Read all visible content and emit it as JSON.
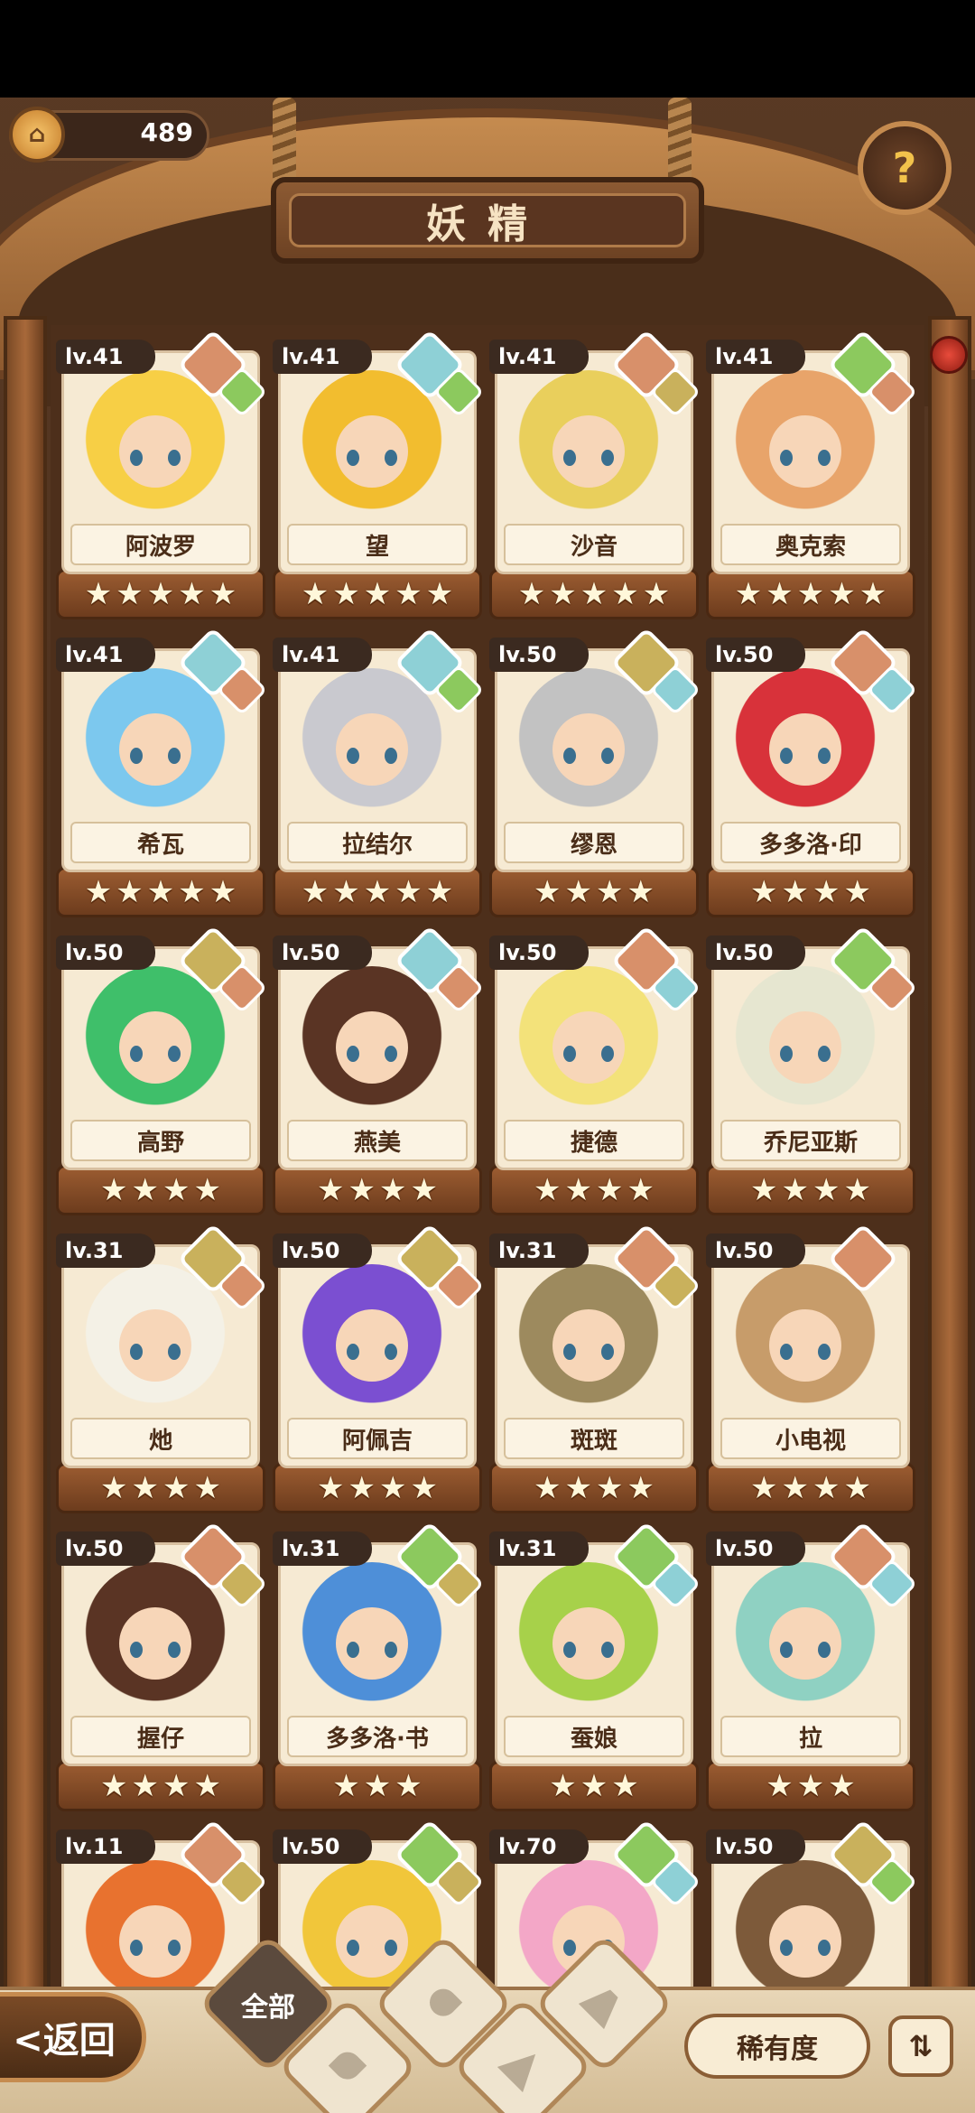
{
  "currency": {
    "icon": "coin-home-icon",
    "value": "489"
  },
  "title": "妖精",
  "help_icon": "question-leaf-icon",
  "fairies": [
    {
      "level": "lv.41",
      "name": "阿波罗",
      "stars": 5,
      "elements": [
        "fire",
        "leaf"
      ],
      "hair": "#f7cf45"
    },
    {
      "level": "lv.41",
      "name": "望",
      "stars": 5,
      "elements": [
        "water",
        "leaf"
      ],
      "hair": "#f2bd2f"
    },
    {
      "level": "lv.41",
      "name": "沙音",
      "stars": 5,
      "elements": [
        "fire",
        "earth"
      ],
      "hair": "#e9cf5c"
    },
    {
      "level": "lv.41",
      "name": "奥克索",
      "stars": 5,
      "elements": [
        "leaf",
        "fire"
      ],
      "hair": "#e8a46a"
    },
    {
      "level": "lv.41",
      "name": "希瓦",
      "stars": 5,
      "elements": [
        "water",
        "fire"
      ],
      "hair": "#7cc8ee"
    },
    {
      "level": "lv.41",
      "name": "拉结尔",
      "stars": 5,
      "elements": [
        "water",
        "leaf"
      ],
      "hair": "#c9c9cf"
    },
    {
      "level": "lv.50",
      "name": "缪恩",
      "stars": 4,
      "elements": [
        "earth",
        "water"
      ],
      "hair": "#c2c2c2"
    },
    {
      "level": "lv.50",
      "name": "多多洛·印",
      "stars": 4,
      "elements": [
        "fire",
        "water"
      ],
      "hair": "#d8323a"
    },
    {
      "level": "lv.50",
      "name": "高野",
      "stars": 4,
      "elements": [
        "earth",
        "fire"
      ],
      "hair": "#3fbf6a"
    },
    {
      "level": "lv.50",
      "name": "燕美",
      "stars": 4,
      "elements": [
        "water",
        "fire"
      ],
      "hair": "#5a3424"
    },
    {
      "level": "lv.50",
      "name": "捷德",
      "stars": 4,
      "elements": [
        "fire",
        "water"
      ],
      "hair": "#f3e27a"
    },
    {
      "level": "lv.50",
      "name": "乔尼亚斯",
      "stars": 4,
      "elements": [
        "leaf",
        "fire"
      ],
      "hair": "#e6e6d0"
    },
    {
      "level": "lv.31",
      "name": "灺",
      "stars": 4,
      "elements": [
        "earth",
        "fire"
      ],
      "hair": "#f4f1e6"
    },
    {
      "level": "lv.50",
      "name": "阿佩吉",
      "stars": 4,
      "elements": [
        "earth",
        "fire"
      ],
      "hair": "#7b4fd1"
    },
    {
      "level": "lv.31",
      "name": "斑斑",
      "stars": 4,
      "elements": [
        "fire",
        "earth"
      ],
      "hair": "#9d8a5e"
    },
    {
      "level": "lv.50",
      "name": "小电视",
      "stars": 4,
      "elements": [
        "fire"
      ],
      "hair": "#c79c6a"
    },
    {
      "level": "lv.50",
      "name": "握仔",
      "stars": 4,
      "elements": [
        "fire",
        "earth"
      ],
      "hair": "#5a3424"
    },
    {
      "level": "lv.31",
      "name": "多多洛·书",
      "stars": 3,
      "elements": [
        "leaf",
        "earth"
      ],
      "hair": "#4e8fd8"
    },
    {
      "level": "lv.31",
      "name": "蚕娘",
      "stars": 3,
      "elements": [
        "leaf",
        "water"
      ],
      "hair": "#a7d14a"
    },
    {
      "level": "lv.50",
      "name": "拉",
      "stars": 3,
      "elements": [
        "fire",
        "water"
      ],
      "hair": "#8fd1c2"
    },
    {
      "level": "lv.11",
      "name": "",
      "stars": 0,
      "elements": [
        "fire",
        "earth"
      ],
      "hair": "#e8722f"
    },
    {
      "level": "lv.50",
      "name": "",
      "stars": 0,
      "elements": [
        "leaf",
        "earth"
      ],
      "hair": "#f1c63a"
    },
    {
      "level": "lv.70",
      "name": "",
      "stars": 0,
      "elements": [
        "leaf",
        "water"
      ],
      "hair": "#f3a7c7"
    },
    {
      "level": "lv.50",
      "name": "",
      "stars": 0,
      "elements": [
        "earth",
        "leaf"
      ],
      "hair": "#7d5a3a"
    }
  ],
  "element_colors": {
    "fire": "#d8906a",
    "water": "#8ed0d6",
    "leaf": "#8cc95e",
    "earth": "#c9b15c"
  },
  "bottom": {
    "back_label": "<返回",
    "filter_all_label": "全部",
    "filters": [
      "all",
      "leaf",
      "water",
      "earth",
      "fire"
    ],
    "rarity_label": "稀有度",
    "sort_icon": "sort-icon"
  }
}
